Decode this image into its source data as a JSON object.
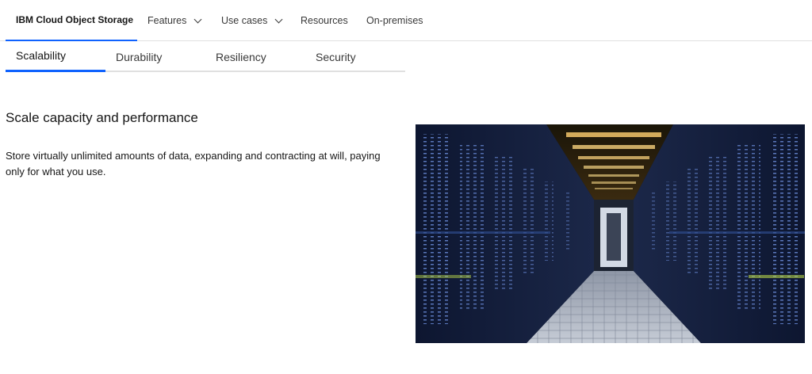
{
  "topnav": {
    "brand": "IBM Cloud Object Storage",
    "items": [
      {
        "label": "Features",
        "has_dropdown": true
      },
      {
        "label": "Use cases",
        "has_dropdown": true
      },
      {
        "label": "Resources",
        "has_dropdown": false
      },
      {
        "label": "On-premises",
        "has_dropdown": false
      }
    ]
  },
  "tabs": [
    {
      "label": "Scalability",
      "active": true
    },
    {
      "label": "Durability",
      "active": false
    },
    {
      "label": "Resiliency",
      "active": false
    },
    {
      "label": "Security",
      "active": false
    }
  ],
  "content": {
    "heading": "Scale capacity and performance",
    "description": "Store virtually unlimited amounts of data, expanding and contracting at will, paying only for what you use."
  },
  "colors": {
    "accent": "#0f62fe",
    "text_primary": "#161616",
    "text_secondary": "#393939",
    "divider": "#e0e0e0"
  }
}
